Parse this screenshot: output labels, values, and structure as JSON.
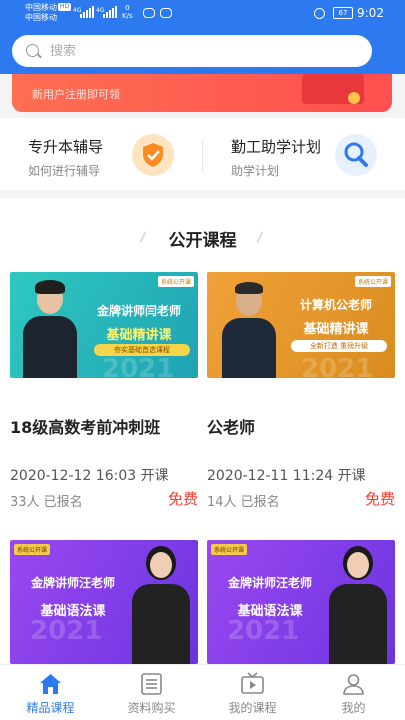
{
  "status_bar": {
    "carrier1": "中国移动",
    "carrier2": "中国移动",
    "hd": "HD",
    "net1": "4G",
    "net2": "4G",
    "speed_value": "0",
    "speed_unit": "K/s",
    "battery": "67",
    "time": "9:02"
  },
  "search": {
    "placeholder": "搜索"
  },
  "banner": {
    "subtitle": "新用户注册即可领"
  },
  "quick_links": [
    {
      "title": "专升本辅导",
      "subtitle": "如何进行辅导",
      "icon": "shield-check-icon",
      "color": "#ff8a1f"
    },
    {
      "title": "勤工助学计划",
      "subtitle": "助学计划",
      "icon": "magnifier-icon",
      "color": "#2d7af0"
    }
  ],
  "section": {
    "title": "公开课程"
  },
  "courses": [
    {
      "tag": "系统公开课",
      "thumb_line1": "金牌讲师闫老师",
      "thumb_line2": "基础精讲课",
      "thumb_line3": "夯实基础首选课程",
      "year": "2021",
      "title": "18级高数考前冲刺班",
      "time": "2020-12-12 16:03 开课",
      "enrolled": "33人 已报名",
      "price": "免费"
    },
    {
      "tag": "系统公开课",
      "thumb_line1": "计算机公老师",
      "thumb_line2": "基础精讲课",
      "thumb_line3": "全新打造 重磅升级",
      "year": "2021",
      "title": "公老师",
      "time": "2020-12-11 11:24 开课",
      "enrolled": "14人 已报名",
      "price": "免费"
    },
    {
      "tag": "系统公开课",
      "thumb_line1": "金牌讲师汪老师",
      "thumb_line2": "基础语法课",
      "year": "2021"
    },
    {
      "tag": "系统公开课",
      "thumb_line1": "金牌讲师汪老师",
      "thumb_line2": "基础语法课",
      "year": "2021"
    }
  ],
  "bottom_nav": [
    {
      "label": "精品课程",
      "icon": "home-icon",
      "active": true
    },
    {
      "label": "资料购买",
      "icon": "document-list-icon",
      "active": false
    },
    {
      "label": "我的课程",
      "icon": "tv-play-icon",
      "active": false
    },
    {
      "label": "我的",
      "icon": "user-icon",
      "active": false
    }
  ],
  "colors": {
    "brand": "#2d7af0",
    "price": "#ff3b30",
    "banner": "#ff5a4e"
  }
}
